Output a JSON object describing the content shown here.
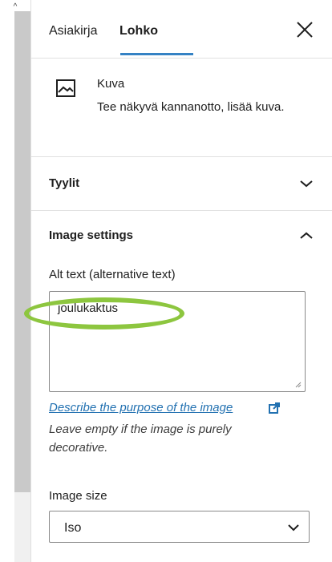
{
  "tabs": {
    "document": "Asiakirja",
    "block": "Lohko"
  },
  "block": {
    "icon": "image-icon",
    "title": "Kuva",
    "description": "Tee näkyvä kannanotto, lisää kuva."
  },
  "sections": {
    "styles": "Tyylit",
    "image_settings": "Image settings"
  },
  "alt_text": {
    "label": "Alt text (alternative text)",
    "value": "joulukaktus",
    "link": "Describe the purpose of the image",
    "help": "Leave empty if the image is purely decorative."
  },
  "image_size": {
    "label": "Image size",
    "selected": "Iso"
  },
  "colors": {
    "accent": "#3582c4",
    "link": "#2271b1",
    "highlight": "#8dc63f"
  }
}
